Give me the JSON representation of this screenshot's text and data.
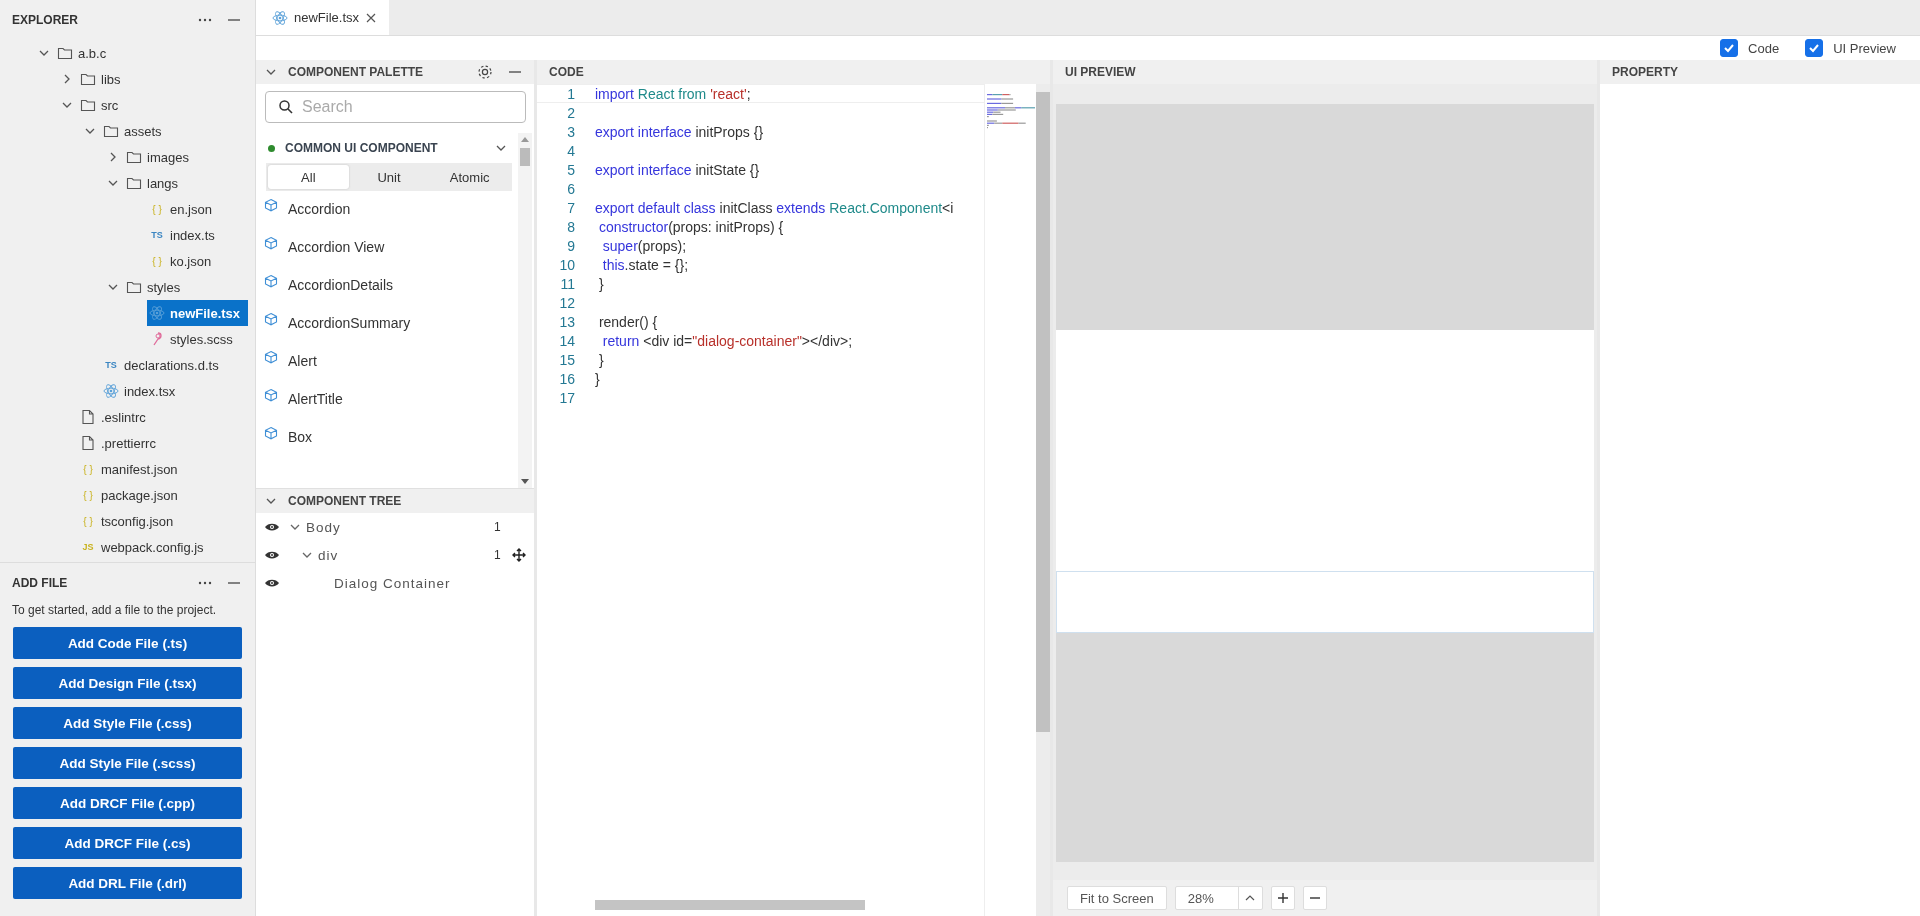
{
  "explorer": {
    "title": "EXPLORER",
    "tree": [
      {
        "kind": "folder",
        "name": "a.b.c",
        "expanded": true,
        "selected": false,
        "children": [
          {
            "kind": "folder",
            "name": "libs",
            "expanded": false,
            "selected": false
          },
          {
            "kind": "folder",
            "name": "src",
            "expanded": true,
            "selected": false,
            "children": [
              {
                "kind": "folder",
                "name": "assets",
                "expanded": true,
                "selected": false,
                "children": [
                  {
                    "kind": "folder",
                    "name": "images",
                    "expanded": false,
                    "selected": false
                  },
                  {
                    "kind": "folder",
                    "name": "langs",
                    "expanded": true,
                    "selected": false,
                    "children": [
                      {
                        "kind": "json",
                        "badge": "{ }",
                        "name": "en.json",
                        "selected": false
                      },
                      {
                        "kind": "ts",
                        "badge": "TS",
                        "name": "index.ts",
                        "selected": false
                      },
                      {
                        "kind": "json",
                        "badge": "{ }",
                        "name": "ko.json",
                        "selected": false
                      }
                    ]
                  },
                  {
                    "kind": "folder",
                    "name": "styles",
                    "expanded": true,
                    "selected": false,
                    "children": [
                      {
                        "kind": "react",
                        "name": "newFile.tsx",
                        "selected": true
                      },
                      {
                        "kind": "scss",
                        "name": "styles.scss",
                        "selected": false
                      }
                    ]
                  }
                ]
              },
              {
                "kind": "ts",
                "badge": "TS",
                "name": "declarations.d.ts",
                "selected": false
              },
              {
                "kind": "react",
                "name": "index.tsx",
                "selected": false
              }
            ]
          },
          {
            "kind": "file",
            "name": ".eslintrc",
            "selected": false
          },
          {
            "kind": "file",
            "name": ".prettierrc",
            "selected": false
          },
          {
            "kind": "json",
            "badge": "{ }",
            "name": "manifest.json",
            "selected": false
          },
          {
            "kind": "json",
            "badge": "{ }",
            "name": "package.json",
            "selected": false
          },
          {
            "kind": "json",
            "badge": "{ }",
            "name": "tsconfig.json",
            "selected": false
          },
          {
            "kind": "js",
            "badge": "JS",
            "name": "webpack.config.js",
            "selected": false
          }
        ]
      }
    ]
  },
  "add_file": {
    "title": "ADD FILE",
    "hint": "To get started, add a file to the project.",
    "buttons": [
      "Add Code File (.ts)",
      "Add Design File (.tsx)",
      "Add Style File (.css)",
      "Add Style File (.scss)",
      "Add DRCF File (.cpp)",
      "Add DRCF File (.cs)",
      "Add DRL File (.drl)"
    ]
  },
  "tabs": [
    {
      "label": "newFile.tsx",
      "selected": true
    }
  ],
  "view_toggles": [
    {
      "label": "Code",
      "checked": true
    },
    {
      "label": "UI Preview",
      "checked": true
    }
  ],
  "component_palette": {
    "title": "COMPONENT PALETTE",
    "search": {
      "placeholder": "Search"
    },
    "category": "COMMON UI COMPONENT",
    "filters": [
      {
        "label": "All",
        "selected": true
      },
      {
        "label": "Unit",
        "selected": false
      },
      {
        "label": "Atomic",
        "selected": false
      }
    ],
    "items": [
      "Accordion",
      "Accordion View",
      "AccordionDetails",
      "AccordionSummary",
      "Alert",
      "AlertTitle",
      "Box"
    ]
  },
  "component_tree": {
    "title": "COMPONENT TREE",
    "nodes": [
      {
        "label": "Body",
        "count": "1",
        "expanded": true,
        "children": [
          {
            "label": "div",
            "count": "1",
            "expanded": true,
            "children": [
              {
                "label": "Dialog Container"
              }
            ]
          }
        ]
      }
    ]
  },
  "code": {
    "title": "CODE",
    "lines": [
      {
        "number": "1",
        "tokens": [
          {
            "kind": "keyword",
            "text": "import"
          },
          {
            "kind": "type",
            "text": " React from"
          },
          {
            "kind": "string",
            "text": " 'react'"
          },
          {
            "kind": "plain",
            "text": ";"
          }
        ]
      },
      {
        "number": "2"
      },
      {
        "number": "3",
        "tokens": [
          {
            "kind": "keyword",
            "text": "export interface"
          },
          {
            "kind": "plain",
            "text": " initProps {}"
          }
        ]
      },
      {
        "number": "4"
      },
      {
        "number": "5",
        "tokens": [
          {
            "kind": "keyword",
            "text": "export interface"
          },
          {
            "kind": "plain",
            "text": " initState {}"
          }
        ]
      },
      {
        "number": "6"
      },
      {
        "number": "7",
        "tokens": [
          {
            "kind": "keyword",
            "text": "export default class"
          },
          {
            "kind": "plain",
            "text": " initClass "
          },
          {
            "kind": "keyword",
            "text": "extends"
          },
          {
            "kind": "type",
            "text": " React.Component"
          },
          {
            "kind": "plain",
            "text": "<i"
          }
        ]
      },
      {
        "number": "8",
        "tokens": [
          {
            "kind": "keyword",
            "text": " constructor"
          },
          {
            "kind": "plain",
            "text": "(props: initProps) {"
          }
        ]
      },
      {
        "number": "9",
        "tokens": [
          {
            "kind": "keyword",
            "text": "  super"
          },
          {
            "kind": "plain",
            "text": "(props);"
          }
        ]
      },
      {
        "number": "10",
        "tokens": [
          {
            "kind": "keyword",
            "text": "  this"
          },
          {
            "kind": "plain",
            "text": ".state = {};"
          }
        ]
      },
      {
        "number": "11",
        "tokens": [
          {
            "kind": "plain",
            "text": " }"
          }
        ]
      },
      {
        "number": "12"
      },
      {
        "number": "13",
        "tokens": [
          {
            "kind": "plain",
            "text": " render() {"
          }
        ]
      },
      {
        "number": "14",
        "tokens": [
          {
            "kind": "keyword",
            "text": "  return"
          },
          {
            "kind": "plain",
            "text": " <div id="
          },
          {
            "kind": "string",
            "text": "\"dialog-container\""
          },
          {
            "kind": "plain",
            "text": "></div>;"
          }
        ]
      },
      {
        "number": "15",
        "tokens": [
          {
            "kind": "plain",
            "text": " }"
          }
        ]
      },
      {
        "number": "16",
        "tokens": [
          {
            "kind": "plain",
            "text": "}"
          }
        ]
      },
      {
        "number": "17"
      }
    ]
  },
  "ui_preview": {
    "title": "UI PREVIEW",
    "fit_button": "Fit to Screen",
    "zoom": "28%"
  },
  "property": {
    "title": "PROPERTY"
  }
}
